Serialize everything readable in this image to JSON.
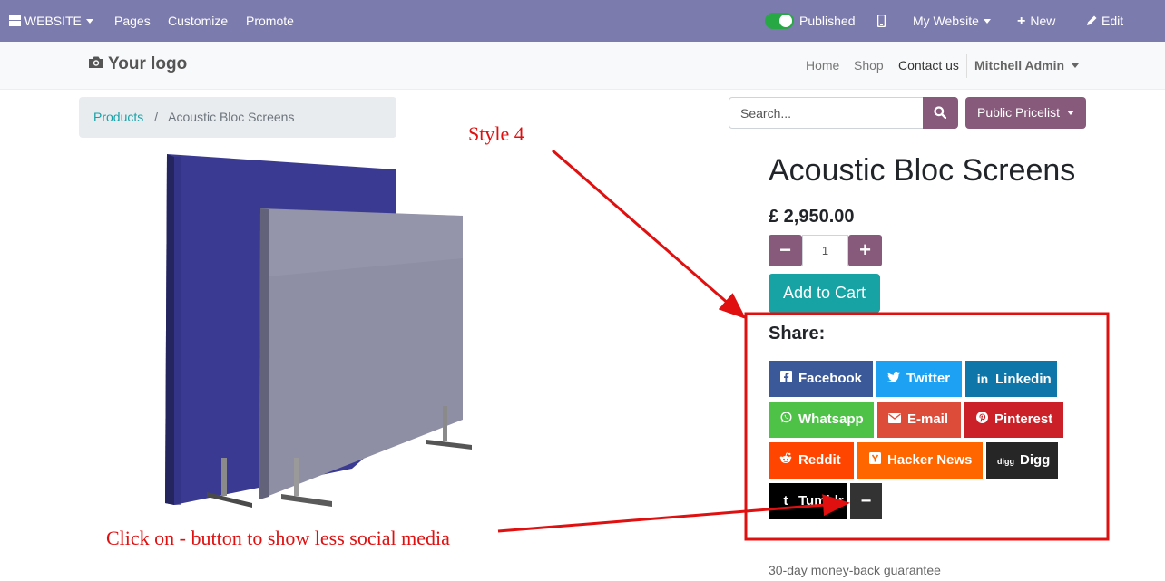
{
  "topbar": {
    "website_label": "WEBSITE",
    "pages": "Pages",
    "customize": "Customize",
    "promote": "Promote",
    "published": "Published",
    "my_website": "My Website",
    "new": "New",
    "edit": "Edit"
  },
  "navbar": {
    "logo": "Your logo",
    "home": "Home",
    "shop": "Shop",
    "contact": "Contact us",
    "user": "Mitchell Admin"
  },
  "breadcrumb": {
    "products": "Products",
    "separator": "/",
    "current": "Acoustic Bloc Screens"
  },
  "search": {
    "placeholder": "Search..."
  },
  "pricelist": "Public Pricelist",
  "product": {
    "title": "Acoustic Bloc Screens",
    "price": "£ 2,950.00",
    "quantity": "1",
    "add_to_cart": "Add to Cart",
    "guarantee": "30-day money-back guarantee"
  },
  "share": {
    "label": "Share:",
    "buttons": [
      {
        "label": "Facebook",
        "icon": "facebook-icon",
        "color": "#3b5998"
      },
      {
        "label": "Twitter",
        "icon": "twitter-icon",
        "color": "#1da1f2"
      },
      {
        "label": "Linkedin",
        "icon": "linkedin-icon",
        "color": "#0e76a8"
      },
      {
        "label": "Whatsapp",
        "icon": "whatsapp-icon",
        "color": "#4dc247"
      },
      {
        "label": "E-mail",
        "icon": "envelope-icon",
        "color": "#dd4b39"
      },
      {
        "label": "Pinterest",
        "icon": "pinterest-icon",
        "color": "#cb2027"
      },
      {
        "label": "Reddit",
        "icon": "reddit-icon",
        "color": "#ff4500"
      },
      {
        "label": "Hacker News",
        "icon": "hacker-news-icon",
        "color": "#ff6600"
      },
      {
        "label": "Digg",
        "icon": "digg-icon",
        "color": "#262626"
      },
      {
        "label": "Tumblr",
        "icon": "tumblr-icon",
        "color": "#000000"
      }
    ],
    "less_button": "−"
  },
  "annotations": {
    "style": "Style 4",
    "hint": "Click on - button to show less social media"
  },
  "colors": {
    "topbar": "#7c7bad",
    "brand": "#875a7b",
    "teal": "#17a2a3",
    "annotation": "#e01010"
  }
}
